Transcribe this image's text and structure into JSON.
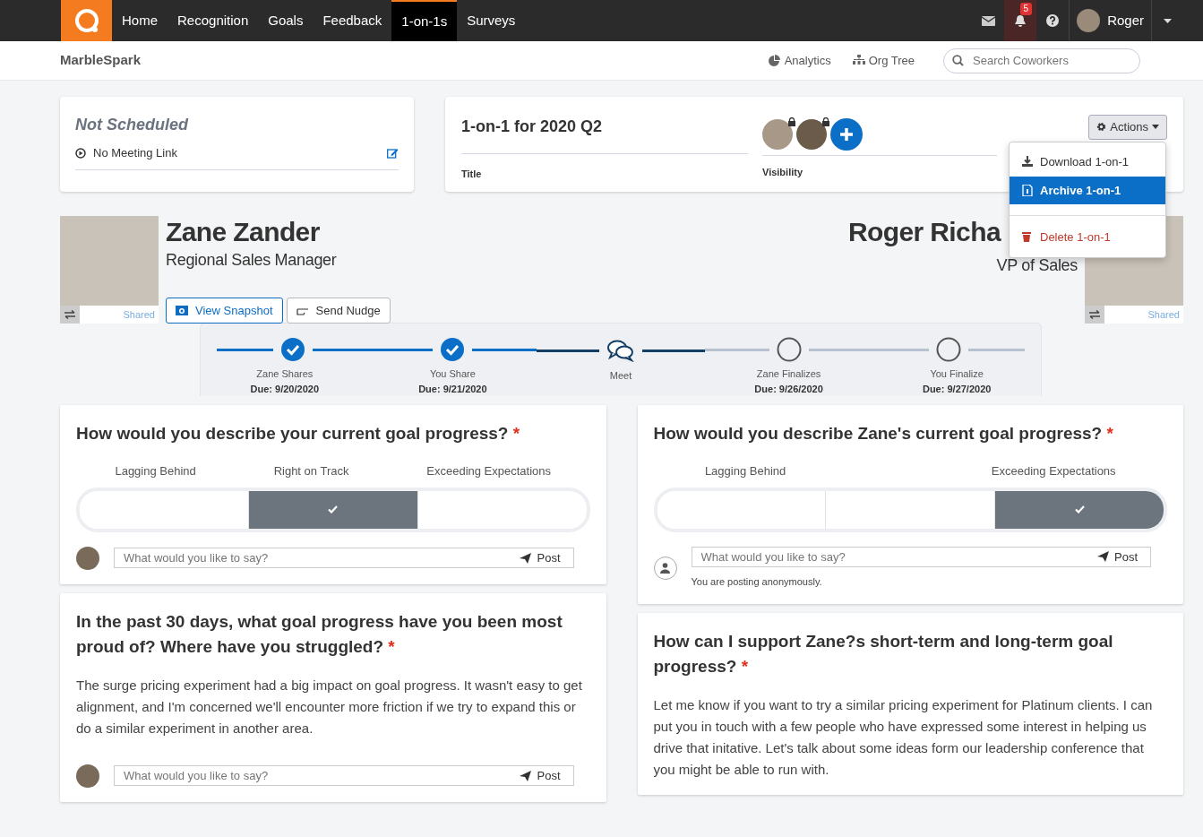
{
  "nav": {
    "items": [
      {
        "label": "Home",
        "selected": false
      },
      {
        "label": "Recognition",
        "selected": false
      },
      {
        "label": "Goals",
        "selected": false
      },
      {
        "label": "Feedback",
        "selected": false
      },
      {
        "label": "1-on-1s",
        "selected": true
      },
      {
        "label": "Surveys",
        "selected": false
      }
    ],
    "notification_count": "5",
    "user": "Roger"
  },
  "subnav": {
    "brand": "MarbleSpark",
    "links": [
      "Analytics",
      "Org Tree"
    ],
    "search": {
      "placeholder": "Search Coworkers"
    }
  },
  "schedule": {
    "title": "Not Scheduled",
    "meeting_link": "No Meeting Link"
  },
  "one_on_one": {
    "title": "1-on-1 for 2020 Q2",
    "title_label": "Title",
    "visibility_label": "Visibility",
    "actions_label": "Actions",
    "actions_menu": [
      {
        "label": "Download 1-on-1",
        "kind": "download",
        "selected": false
      },
      {
        "label": "Archive 1-on-1",
        "kind": "archive",
        "selected": true
      },
      {
        "label": "Delete 1-on-1",
        "kind": "delete",
        "selected": false
      }
    ]
  },
  "people": [
    {
      "name": "Zane Zander",
      "role": "Regional Sales Manager",
      "shared_label": "Shared",
      "buttons": [
        "View Snapshot",
        "Send Nudge"
      ]
    },
    {
      "name": "Roger Richa",
      "role": "VP of Sales",
      "shared_label": "Shared"
    }
  ],
  "steps": [
    {
      "kind": "task",
      "label": "Zane Shares",
      "due": "Due: 9/20/2020",
      "done": true
    },
    {
      "kind": "task",
      "label": "You Share",
      "due": "Due: 9/21/2020",
      "done": true
    },
    {
      "kind": "meeting",
      "label": "Meet"
    },
    {
      "kind": "task",
      "label": "Zane Finalizes",
      "due": "Due: 9/26/2020",
      "done": false
    },
    {
      "kind": "task",
      "label": "You Finalize",
      "due": "Due: 9/27/2020",
      "done": false
    }
  ],
  "columns": [
    [
      {
        "kind": "rating",
        "question": "How would you describe your current goal progress?",
        "required_mark": "*",
        "options": [
          {
            "label": "Lagging Behind",
            "selected": false
          },
          {
            "label": "Right on Track",
            "selected": true
          },
          {
            "label": "Exceeding Expectations",
            "selected": false
          }
        ],
        "comment": {
          "placeholder": "What would you like to say?",
          "post": "Post",
          "anonymous": false
        }
      },
      {
        "kind": "text",
        "question": "In the past 30 days, what goal progress have you been most proud of? Where have you struggled?",
        "required_mark": "*",
        "answer": "The surge pricing experiment had a big impact on goal progress. It wasn't easy to get alignment, and I'm concerned we'll encounter more friction if we try to expand this or do a similar experiment in another area.",
        "comment": {
          "placeholder": "What would you like to say?",
          "post": "Post",
          "anonymous": false
        }
      }
    ],
    [
      {
        "kind": "rating",
        "question": "How would you describe Zane's current goal progress?",
        "required_mark": "*",
        "options": [
          {
            "label": "Lagging Behind",
            "selected": false
          },
          {
            "selected": false
          },
          {
            "label": "Exceeding Expectations",
            "selected": true
          }
        ],
        "comment": {
          "placeholder": "What would you like to say?",
          "post": "Post",
          "anonymous": true,
          "note": "You are posting anonymously."
        }
      },
      {
        "kind": "text",
        "question": "How can I support Zane?s short-term and long-term goal progress?",
        "required_mark": "*",
        "answer": "Let me know if you want to try a similar pricing experiment for Platinum clients. I can put you in touch with a few people who have expressed some interest in helping us drive that initative. Let's talk about some ideas form our leadership conference that you might be able to run with."
      }
    ]
  ]
}
